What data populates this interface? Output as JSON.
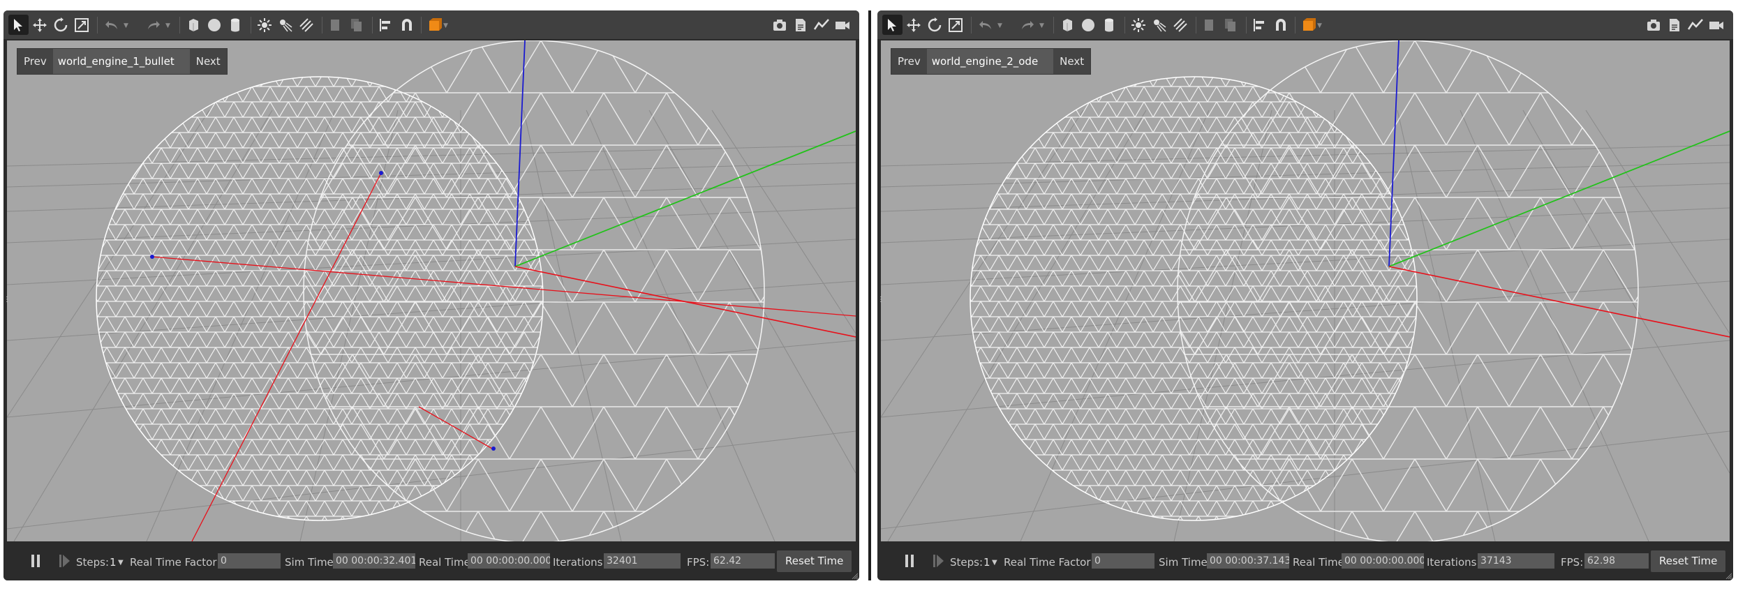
{
  "panels": [
    {
      "world_nav": {
        "prev_label": "Prev",
        "world_name": "world_engine_1_bullet",
        "next_label": "Next"
      },
      "status": {
        "steps_label": "Steps:",
        "steps_value": "1",
        "rtf_label": "Real Time Factor:",
        "rtf_value": "0",
        "sim_time_label": "Sim Time:",
        "sim_time_value": "00 00:00:32.401",
        "real_time_label": "Real Time:",
        "real_time_value": "00 00:00:00.000",
        "iterations_label": "Iterations:",
        "iterations_value": "32401",
        "fps_label": "FPS:",
        "fps_value": "62.42",
        "reset_label": "Reset Time"
      }
    },
    {
      "world_nav": {
        "prev_label": "Prev",
        "world_name": "world_engine_2_ode",
        "next_label": "Next"
      },
      "status": {
        "steps_label": "Steps:",
        "steps_value": "1",
        "rtf_label": "Real Time Factor:",
        "rtf_value": "0",
        "sim_time_label": "Sim Time:",
        "sim_time_value": "00 00:00:37.143",
        "real_time_label": "Real Time:",
        "real_time_value": "00 00:00:00.000",
        "iterations_label": "Iterations:",
        "iterations_value": "37143",
        "fps_label": "FPS:",
        "fps_value": "62.98",
        "reset_label": "Reset Time"
      }
    }
  ],
  "toolbar_icons": [
    "select-icon",
    "translate-icon",
    "rotate-icon",
    "scale-icon",
    "undo-icon",
    "redo-icon",
    "box-icon",
    "sphere-icon",
    "cylinder-icon",
    "point-light-icon",
    "spot-light-icon",
    "directional-light-icon",
    "copy-icon",
    "paste-icon",
    "align-icon",
    "snap-icon",
    "view-angle-icon",
    "screenshot-icon",
    "log-icon",
    "plot-icon",
    "video-record-icon"
  ],
  "colors": {
    "viewport_bg": "#a6a6a6",
    "x_axis": "#e8101a",
    "y_axis": "#22c21a",
    "z_axis": "#1a1ad0",
    "wireframe": "#ffffff",
    "toolbar_bg": "#404040",
    "accent_orange": "#f08a16"
  }
}
